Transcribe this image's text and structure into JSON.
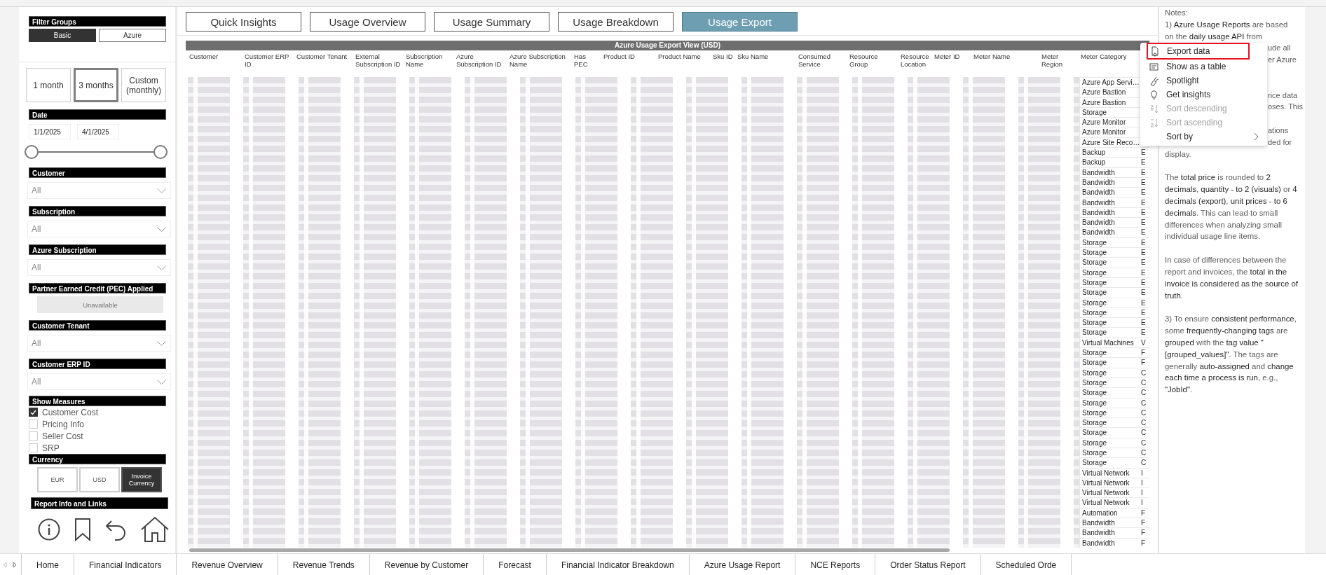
{
  "filter_groups": {
    "title": "Filter Groups",
    "options": [
      {
        "label": "Basic",
        "selected": true
      },
      {
        "label": "Azure",
        "selected": false
      }
    ]
  },
  "period_options": [
    {
      "label": "1 month",
      "selected": false
    },
    {
      "label": "3 months",
      "selected": true
    },
    {
      "label": "Custom (monthly)",
      "selected": false
    }
  ],
  "date": {
    "title": "Date",
    "start": "1/1/2025",
    "end": "4/1/2025"
  },
  "filters": [
    {
      "kind": "dropdown",
      "title": "Customer",
      "value": "All"
    },
    {
      "kind": "dropdown",
      "title": "Subscription",
      "value": "All"
    },
    {
      "kind": "dropdown",
      "title": "Azure Subscription",
      "value": "All"
    },
    {
      "kind": "unavailable",
      "title": "Partner Earned Credit (PEC) Applied",
      "value": "Unavailable"
    },
    {
      "kind": "dropdown",
      "title": "Customer Tenant",
      "value": "All"
    },
    {
      "kind": "dropdown",
      "title": "Customer ERP ID",
      "value": "All"
    }
  ],
  "show_measures": {
    "title": "Show Measures",
    "items": [
      {
        "label": "Customer Cost",
        "checked": true
      },
      {
        "label": "Pricing Info",
        "checked": false
      },
      {
        "label": "Seller Cost",
        "checked": false
      },
      {
        "label": "SRP",
        "checked": false
      }
    ]
  },
  "currency": {
    "title": "Currency",
    "options": [
      {
        "label": "EUR",
        "selected": false
      },
      {
        "label": "USD",
        "selected": false
      },
      {
        "label": "Invoice Currency",
        "selected": true
      }
    ]
  },
  "report_info": {
    "title": "Report Info and Links"
  },
  "page_tabs": [
    {
      "label": "Quick Insights",
      "selected": false
    },
    {
      "label": "Usage Overview",
      "selected": false
    },
    {
      "label": "Usage Summary",
      "selected": false
    },
    {
      "label": "Usage Breakdown",
      "selected": false
    },
    {
      "label": "Usage Export",
      "selected": true
    }
  ],
  "table": {
    "title": "Azure Usage Export View (USD)",
    "columns": [
      "Customer",
      "Customer ERP ID",
      "Customer Tenant",
      "External Subscription ID",
      "Subscription Name",
      "Azure Subscription ID",
      "Azure Subscription Name",
      "Has PEC",
      "Product ID",
      "Product Name",
      "Sku ID",
      "Sku Name",
      "Consumed Service",
      "Resource Group",
      "Resource Location",
      "Meter ID",
      "Meter Name",
      "Meter Region",
      "Meter Category"
    ],
    "rows": [
      {
        "meter_category": "Azure App Servi…"
      },
      {
        "meter_category": "Azure Bastion"
      },
      {
        "meter_category": "Azure Bastion"
      },
      {
        "meter_category": "Storage"
      },
      {
        "meter_category": "Azure Monitor"
      },
      {
        "meter_category": "Azure Monitor"
      },
      {
        "meter_category": "Azure Site Reco…"
      },
      {
        "meter_category": "Backup",
        "column_20": "E"
      },
      {
        "meter_category": "Backup",
        "column_20": "E"
      },
      {
        "meter_category": "Bandwidth",
        "column_20": "E"
      },
      {
        "meter_category": "Bandwidth",
        "column_20": "E"
      },
      {
        "meter_category": "Bandwidth",
        "column_20": "E"
      },
      {
        "meter_category": "Bandwidth",
        "column_20": "E"
      },
      {
        "meter_category": "Bandwidth",
        "column_20": "E"
      },
      {
        "meter_category": "Bandwidth",
        "column_20": "E"
      },
      {
        "meter_category": "Bandwidth",
        "column_20": "E"
      },
      {
        "meter_category": "Storage",
        "column_20": "E"
      },
      {
        "meter_category": "Storage",
        "column_20": "E"
      },
      {
        "meter_category": "Storage",
        "column_20": "E"
      },
      {
        "meter_category": "Storage",
        "column_20": "E"
      },
      {
        "meter_category": "Storage",
        "column_20": "E"
      },
      {
        "meter_category": "Storage",
        "column_20": "E"
      },
      {
        "meter_category": "Storage",
        "column_20": "E"
      },
      {
        "meter_category": "Storage",
        "column_20": "E"
      },
      {
        "meter_category": "Storage",
        "column_20": "E"
      },
      {
        "meter_category": "Storage",
        "column_20": "E"
      },
      {
        "meter_category": "Virtual Machines",
        "column_20": "V"
      },
      {
        "meter_category": "Storage",
        "column_20": "F"
      },
      {
        "meter_category": "Storage",
        "column_20": "F"
      },
      {
        "meter_category": "Storage",
        "column_20": "C"
      },
      {
        "meter_category": "Storage",
        "column_20": "C"
      },
      {
        "meter_category": "Storage",
        "column_20": "C"
      },
      {
        "meter_category": "Storage",
        "column_20": "C"
      },
      {
        "meter_category": "Storage",
        "column_20": "C"
      },
      {
        "meter_category": "Storage",
        "column_20": "C"
      },
      {
        "meter_category": "Storage",
        "column_20": "C"
      },
      {
        "meter_category": "Storage",
        "column_20": "C"
      },
      {
        "meter_category": "Storage",
        "column_20": "C"
      },
      {
        "meter_category": "Storage",
        "column_20": "C"
      },
      {
        "meter_category": "Virtual Network",
        "column_20": "I"
      },
      {
        "meter_category": "Virtual Network",
        "column_20": "I"
      },
      {
        "meter_category": "Virtual Network",
        "column_20": "I"
      },
      {
        "meter_category": "Virtual Network",
        "column_20": "I"
      },
      {
        "meter_category": "Automation",
        "column_20": "F"
      },
      {
        "meter_category": "Bandwidth",
        "column_20": "F"
      },
      {
        "meter_category": "Bandwidth",
        "column_20": "F"
      },
      {
        "meter_category": "Bandwidth",
        "column_20": "F"
      }
    ]
  },
  "context_menu": {
    "items": [
      {
        "label": "Export data",
        "highlighted": true,
        "disabled": false,
        "has_submenu": false
      },
      {
        "label": "Show as a table",
        "highlighted": false,
        "disabled": false,
        "has_submenu": false
      },
      {
        "label": "Spotlight",
        "highlighted": false,
        "disabled": false,
        "has_submenu": false
      },
      {
        "label": "Get insights",
        "highlighted": false,
        "disabled": false,
        "has_submenu": false
      },
      {
        "label": "Sort descending",
        "highlighted": false,
        "disabled": true,
        "has_submenu": false
      },
      {
        "label": "Sort ascending",
        "highlighted": false,
        "disabled": true,
        "has_submenu": false
      },
      {
        "label": "Sort by",
        "highlighted": false,
        "disabled": false,
        "has_submenu": true
      }
    ]
  },
  "notes": {
    "heading": "Notes:",
    "visible_lines": [
      {
        "kind": "full",
        "text": "1) **Azure Usage Reports** are based"
      },
      {
        "kind": "full",
        "text": "on the **daily usage API** from"
      },
      {
        "kind": "tail",
        "text": "ude all"
      },
      {
        "kind": "tail",
        "text": "er Azure"
      },
      {
        "kind": "gap"
      },
      {
        "kind": "gap"
      },
      {
        "kind": "tail",
        "text": "rice data"
      },
      {
        "kind": "tail",
        "text": "oses. This"
      },
      {
        "kind": "gap"
      },
      {
        "kind": "tail",
        "text": "ations"
      },
      {
        "kind": "tail",
        "text": "ded for"
      },
      {
        "kind": "full",
        "text": "display."
      }
    ],
    "paragraphs": [
      "The **total price** is rounded to **2 decimals**, **quantity - to 2 (visuals)** or **4 decimals (export)**, **unit prices - to 6 decimals**. This can lead to small differences when analyzing small individual usage line items.",
      "In case of differences between the report and invoices, the **total in the invoice is considered as the source of truth**.",
      "3) To ensure **consistent performance**, some **frequently-changing tags** are **grouped** with the **tag value \"[grouped_values]\"**. The tags are generally **auto-assigned** and **change each time a process is run**, e.g., **\"JobId\"**."
    ]
  },
  "bottom_tabs": [
    "Home",
    "Financial Indicators",
    "Revenue Overview",
    "Revenue Trends",
    "Revenue by Customer",
    "Forecast",
    "Financial Indicator Breakdown",
    "Azure Usage Report",
    "NCE Reports",
    "Order Status Report",
    "Scheduled Orde"
  ]
}
